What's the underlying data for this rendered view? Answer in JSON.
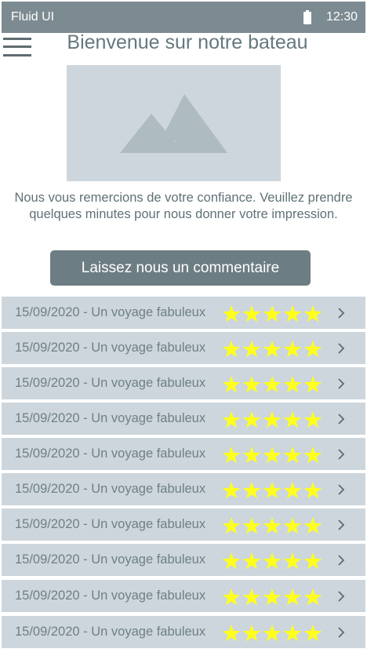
{
  "status_bar": {
    "app_name": "Fluid UI",
    "time": "12:30",
    "icons": [
      "battery-icon"
    ]
  },
  "header": {
    "menu_icon": "hamburger-menu-icon",
    "title": "Bienvenue sur notre bateau"
  },
  "hero": {
    "icon": "image-placeholder-icon"
  },
  "intro": {
    "text": "Nous vous remercions de votre confiance. Veuillez prendre quelques minutes pour nous donner votre impression."
  },
  "cta": {
    "label": "Laissez nous un commentaire"
  },
  "reviews": [
    {
      "label": "15/09/2020 - Un voyage fabuleux",
      "rating": 5,
      "max_rating": 5
    },
    {
      "label": "15/09/2020 - Un voyage fabuleux",
      "rating": 5,
      "max_rating": 5
    },
    {
      "label": "15/09/2020 - Un voyage fabuleux",
      "rating": 5,
      "max_rating": 5
    },
    {
      "label": "15/09/2020 - Un voyage fabuleux",
      "rating": 5,
      "max_rating": 5
    },
    {
      "label": "15/09/2020 - Un voyage fabuleux",
      "rating": 5,
      "max_rating": 5
    },
    {
      "label": "15/09/2020 - Un voyage fabuleux",
      "rating": 5,
      "max_rating": 5
    },
    {
      "label": "15/09/2020 - Un voyage fabuleux",
      "rating": 5,
      "max_rating": 5
    },
    {
      "label": "15/09/2020 - Un voyage fabuleux",
      "rating": 5,
      "max_rating": 5
    },
    {
      "label": "15/09/2020 - Un voyage fabuleux",
      "rating": 5,
      "max_rating": 5
    },
    {
      "label": "15/09/2020 - Un voyage fabuleux",
      "rating": 5,
      "max_rating": 5
    }
  ],
  "colors": {
    "status_bar": "#7c8b91",
    "list_row": "#cdd6dc",
    "button": "#6c7d83",
    "star": "#ffff1e",
    "title_text": "#66787d",
    "placeholder": "#cdd6dc",
    "placeholder_shape": "#aebbc0"
  }
}
